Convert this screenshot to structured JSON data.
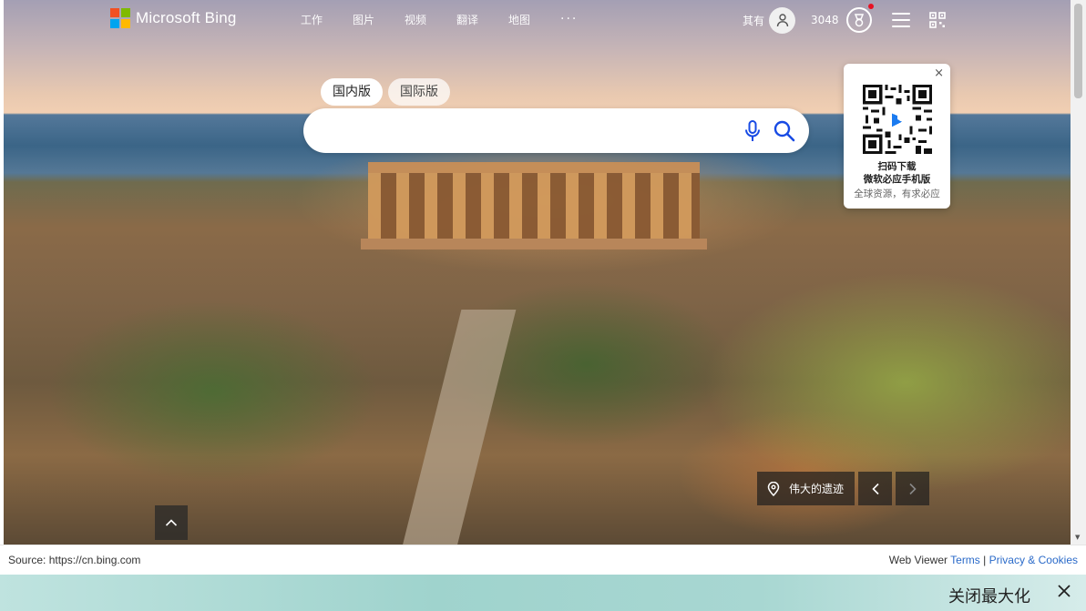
{
  "header": {
    "logo_text": "Microsoft Bing",
    "logo_colors": [
      "#f25022",
      "#7fba00",
      "#00a4ef",
      "#ffb900"
    ],
    "nav": [
      {
        "label": "工作"
      },
      {
        "label": "图片"
      },
      {
        "label": "视频"
      },
      {
        "label": "翻译"
      },
      {
        "label": "地图"
      },
      {
        "label": "···"
      }
    ],
    "login_label": "其有",
    "points": "3048"
  },
  "search": {
    "tabs": [
      {
        "label": "国内版",
        "active": true
      },
      {
        "label": "国际版",
        "active": false
      }
    ],
    "input_value": "",
    "placeholder": "",
    "icons": [
      "mic-icon",
      "search-icon"
    ]
  },
  "qr_popup": {
    "close_label": "×",
    "line1": "扫码下载",
    "line2": "微软必应手机版",
    "line3": "全球资源，有求必应"
  },
  "image_caption": {
    "title": "伟大的遗迹",
    "icon": "location-pin-icon"
  },
  "footer": {
    "source": "Source: https://cn.bing.com",
    "viewer_label": "Web Viewer",
    "terms": "Terms",
    "separator": "|",
    "privacy": "Privacy & Cookies"
  },
  "bottombar": {
    "close_maximize": "关闭最大化"
  },
  "colors": {
    "link": "#2a6ac9",
    "reward_dot": "#e81123",
    "bottombar": "#9fd3cd"
  }
}
